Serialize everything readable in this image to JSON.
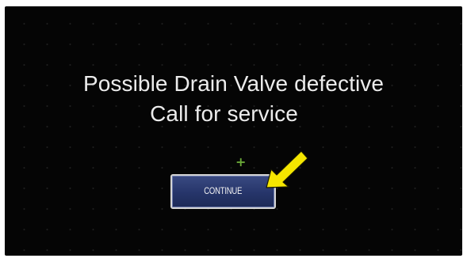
{
  "dialog": {
    "message_line_1": "Possible Drain Valve defective",
    "message_line_2": "Call for service",
    "continue_label": "CONTINUE"
  },
  "icons": {
    "crosshair": "crosshair-icon",
    "pointer": "yellow-arrow-icon"
  },
  "colors": {
    "screen_background": "#050505",
    "message_text": "#ececec",
    "button_fill": "#26356a",
    "button_border": "#d4d4d4",
    "crosshair": "#6aa838",
    "arrow": "#f5e600"
  }
}
